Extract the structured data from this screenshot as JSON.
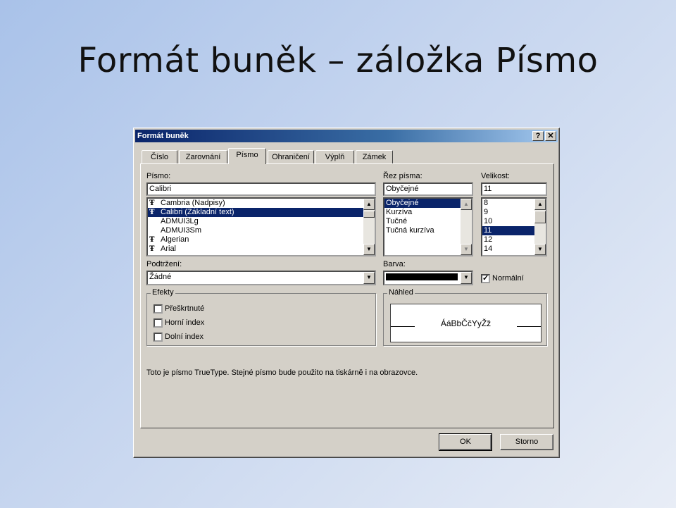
{
  "slide": {
    "title": "Formát buněk – záložka Písmo"
  },
  "dialog": {
    "title": "Formát buněk",
    "help_glyph": "?",
    "close_glyph": "✕",
    "tabs": [
      "Číslo",
      "Zarovnání",
      "Písmo",
      "Ohraničení",
      "Výplň",
      "Zámek"
    ],
    "active_tab": "Písmo",
    "font": {
      "label": "Písmo:",
      "value": "Calibri",
      "items": [
        {
          "name": "Cambria (Nadpisy)",
          "icon": "truetype-icon",
          "selected": false
        },
        {
          "name": "Calibri (Základní text)",
          "icon": "truetype-icon",
          "selected": true
        },
        {
          "name": "ADMUI3Lg",
          "icon": "",
          "selected": false
        },
        {
          "name": "ADMUI3Sm",
          "icon": "",
          "selected": false
        },
        {
          "name": "Algerian",
          "icon": "truetype-icon",
          "selected": false
        },
        {
          "name": "Arial",
          "icon": "truetype-icon",
          "selected": false
        }
      ]
    },
    "style": {
      "label": "Řez písma:",
      "value": "Obyčejné",
      "items": [
        "Obyčejné",
        "Kurzíva",
        "Tučné",
        "Tučná kurzíva"
      ],
      "selected_index": 0
    },
    "size": {
      "label": "Velikost:",
      "value": "11",
      "items": [
        "8",
        "9",
        "10",
        "11",
        "12",
        "14"
      ],
      "selected_index": 3
    },
    "underline": {
      "label": "Podtržení:",
      "value": "Žádné"
    },
    "color": {
      "label": "Barva:",
      "value_color": "#000000"
    },
    "normal": {
      "label": "Normální",
      "checked": true
    },
    "effects": {
      "label": "Efekty",
      "items": [
        {
          "label": "Přeškrtnuté",
          "checked": false
        },
        {
          "label": "Horní index",
          "checked": false
        },
        {
          "label": "Dolní index",
          "checked": false
        }
      ]
    },
    "preview": {
      "label": "Náhled",
      "sample": "ÁáBbČčYyŽž"
    },
    "info": "Toto je písmo TrueType. Stejné písmo bude použito na tiskárně i na obrazovce.",
    "buttons": {
      "ok": "OK",
      "cancel": "Storno"
    },
    "glyphs": {
      "up": "▲",
      "down": "▼",
      "check": "✓",
      "truetype": "Ŧ"
    },
    "colors": {
      "titlebar": "#0a246a",
      "selection": "#0a246a",
      "face": "#d4d0c8"
    }
  }
}
